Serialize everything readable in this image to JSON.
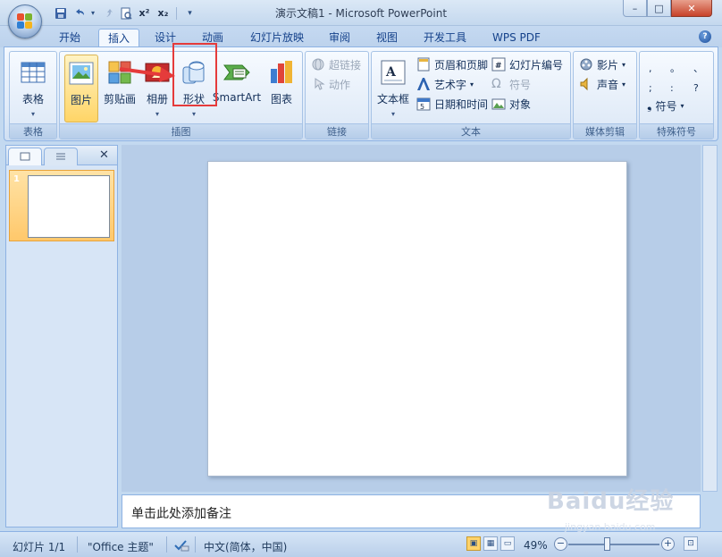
{
  "window": {
    "title": "演示文稿1 - Microsoft PowerPoint",
    "minimize": "–",
    "maximize": "□",
    "close": "✕"
  },
  "qat": [
    "save-icon",
    "undo-icon",
    "redo-icon",
    "print-preview-icon",
    "superscript-icon",
    "subscript-icon",
    "customize-qat-icon"
  ],
  "qat_labels": {
    "superscript": "x²",
    "subscript": "x₂",
    "dropdown": "▾"
  },
  "tabs": [
    {
      "label": "开始"
    },
    {
      "label": "插入"
    },
    {
      "label": "设计"
    },
    {
      "label": "动画"
    },
    {
      "label": "幻灯片放映"
    },
    {
      "label": "审阅"
    },
    {
      "label": "视图"
    },
    {
      "label": "开发工具"
    },
    {
      "label": "WPS PDF"
    }
  ],
  "active_tab": "插入",
  "help": "?",
  "ribbon": {
    "tables": {
      "group": "表格",
      "table": "表格"
    },
    "illustrations": {
      "group": "插图",
      "picture": "图片",
      "clipart": "剪贴画",
      "album": "相册",
      "shapes": "形状",
      "smartart": "SmartArt",
      "chart": "图表"
    },
    "links": {
      "group": "链接",
      "hyperlink": "超链接",
      "action": "动作"
    },
    "text": {
      "group": "文本",
      "textbox": "文本框",
      "header_footer": "页眉和页脚",
      "wordart": "艺术字",
      "datetime": "日期和时间",
      "slide_number": "幻灯片编号",
      "symbol": "符号",
      "object": "对象"
    },
    "media": {
      "group": "媒体剪辑",
      "movie": "影片",
      "sound": "声音"
    },
    "special": {
      "group": "特殊符号",
      "symbol": "符号",
      "chars": [
        ",",
        "。",
        "、",
        ";",
        ":",
        "?"
      ]
    }
  },
  "slides_pane": {
    "slide_number": "1",
    "close": "✕"
  },
  "notes_placeholder": "单击此处添加备注",
  "status": {
    "slide": "幻灯片 1/1",
    "theme": "\"Office 主题\"",
    "language": "中文(简体，中国)",
    "zoom": "49%",
    "zoom_fraction": 0.49
  },
  "colors": {
    "accent": "#e53b3b",
    "ribbon_bg": "#dfeaf8",
    "selected": "#ffd567"
  },
  "watermark": {
    "brand": "Baidu经验",
    "url": "jingyan.baidu.com"
  }
}
